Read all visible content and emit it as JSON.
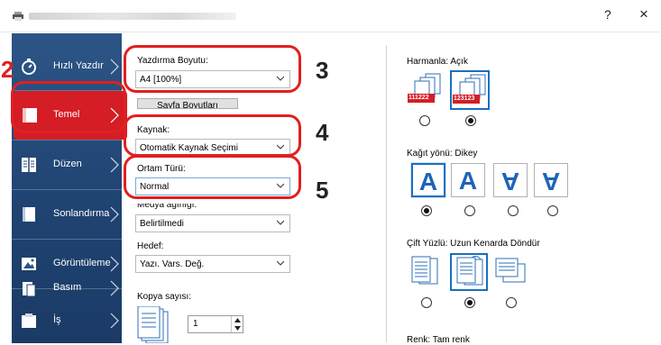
{
  "window": {
    "help_label": "?",
    "close_label": "×"
  },
  "sidebar": {
    "items": [
      {
        "label": "Hızlı Yazdır"
      },
      {
        "label": "Temel"
      },
      {
        "label": "Düzen"
      },
      {
        "label": "Sonlandırma"
      },
      {
        "label": "Görüntüleme"
      },
      {
        "label": "Basım"
      },
      {
        "label": "İş"
      }
    ]
  },
  "callouts": {
    "n2": "2",
    "n3": "3",
    "n4": "4",
    "n5": "5"
  },
  "main": {
    "print_size": {
      "label": "Yazdırma Boyutu:",
      "value": "A4  [100%]"
    },
    "page_sizes_button": "Sayfa Boyutları",
    "source": {
      "label": "Kaynak:",
      "value": "Otomatik Kaynak Seçimi"
    },
    "media_type": {
      "label": "Ortam Türü:",
      "value": "Normal"
    },
    "media_weight": {
      "label": "Medya ağırlığı:",
      "value": "Belirtilmedi"
    },
    "destination": {
      "label": "Hedef:",
      "value": "Yazı. Vars. Değ."
    },
    "copies": {
      "label": "Kopya sayısı:",
      "value": "1"
    }
  },
  "right": {
    "collate": {
      "label": "Harmanla:",
      "value": "Açık",
      "off_text": "111222",
      "on_text": "123123"
    },
    "orientation": {
      "label": "Kağıt yönü:",
      "value": "Dikey"
    },
    "duplex": {
      "label": "Çift Yüzlü:",
      "value": "Uzun Kenarda Döndür"
    },
    "color": {
      "label": "Renk:",
      "value": "Tam renk"
    }
  },
  "colors": {
    "accent_red": "#e02020",
    "sidebar_blue": "#1f4270",
    "select_blue": "#1b6fbf"
  }
}
